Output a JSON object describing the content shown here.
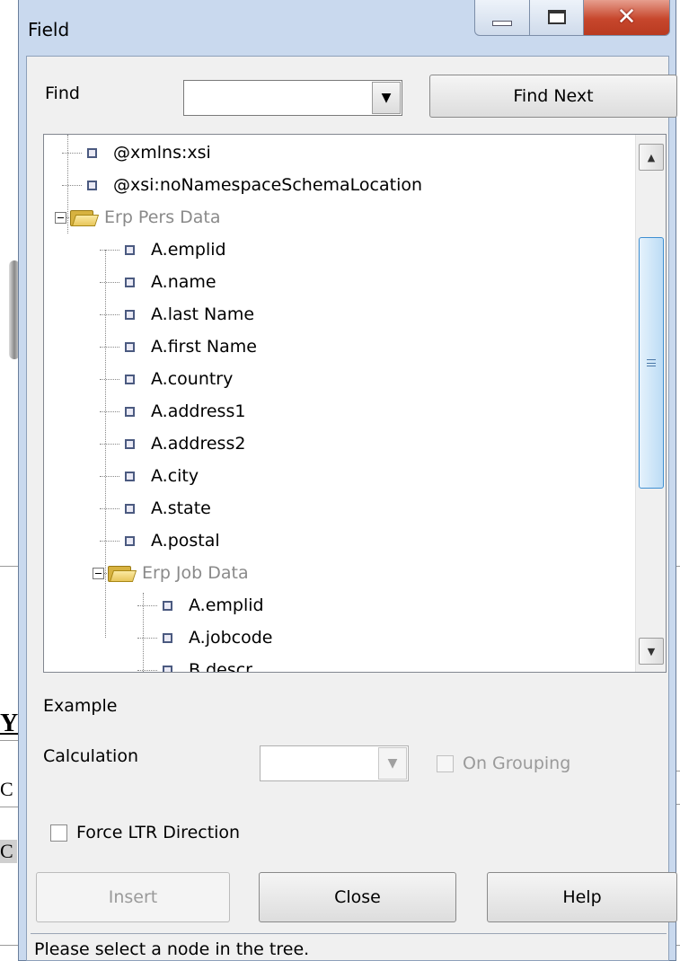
{
  "background": {
    "fragment_y": "Y",
    "fragment_c1": "C",
    "fragment_c2": "C"
  },
  "window": {
    "title": "Field",
    "buttons": {
      "minimize": "minimize-icon",
      "maximize": "maximize-icon",
      "close": "close-icon"
    }
  },
  "find": {
    "label": "Find",
    "value": "",
    "find_next_label": "Find Next"
  },
  "tree": {
    "rows": [
      {
        "label": "@xmlns:xsi",
        "type": "leaf",
        "depth": 0
      },
      {
        "label": "@xsi:noNamespaceSchemaLocation",
        "type": "leaf",
        "depth": 0
      },
      {
        "label": "Erp Pers Data",
        "type": "folder",
        "depth": 0
      },
      {
        "label": "A.emplid",
        "type": "leaf",
        "depth": 1
      },
      {
        "label": "A.name",
        "type": "leaf",
        "depth": 1
      },
      {
        "label": "A.last Name",
        "type": "leaf",
        "depth": 1
      },
      {
        "label": "A.first Name",
        "type": "leaf",
        "depth": 1
      },
      {
        "label": "A.country",
        "type": "leaf",
        "depth": 1
      },
      {
        "label": "A.address1",
        "type": "leaf",
        "depth": 1
      },
      {
        "label": "A.address2",
        "type": "leaf",
        "depth": 1
      },
      {
        "label": "A.city",
        "type": "leaf",
        "depth": 1
      },
      {
        "label": "A.state",
        "type": "leaf",
        "depth": 1
      },
      {
        "label": "A.postal",
        "type": "leaf",
        "depth": 1
      },
      {
        "label": "Erp Job Data",
        "type": "folder",
        "depth": 1
      },
      {
        "label": "A.emplid",
        "type": "leaf",
        "depth": 2
      },
      {
        "label": "A.jobcode",
        "type": "leaf",
        "depth": 2
      },
      {
        "label": "B.descr",
        "type": "leaf",
        "depth": 2
      }
    ]
  },
  "example": {
    "label": "Example"
  },
  "calculation": {
    "label": "Calculation",
    "value": "",
    "on_grouping_label": "On Grouping"
  },
  "force_ltr": {
    "label": "Force LTR Direction",
    "checked": false
  },
  "buttons": {
    "insert": "Insert",
    "close": "Close",
    "help": "Help"
  },
  "status": {
    "text": "Please select a node in the tree."
  }
}
